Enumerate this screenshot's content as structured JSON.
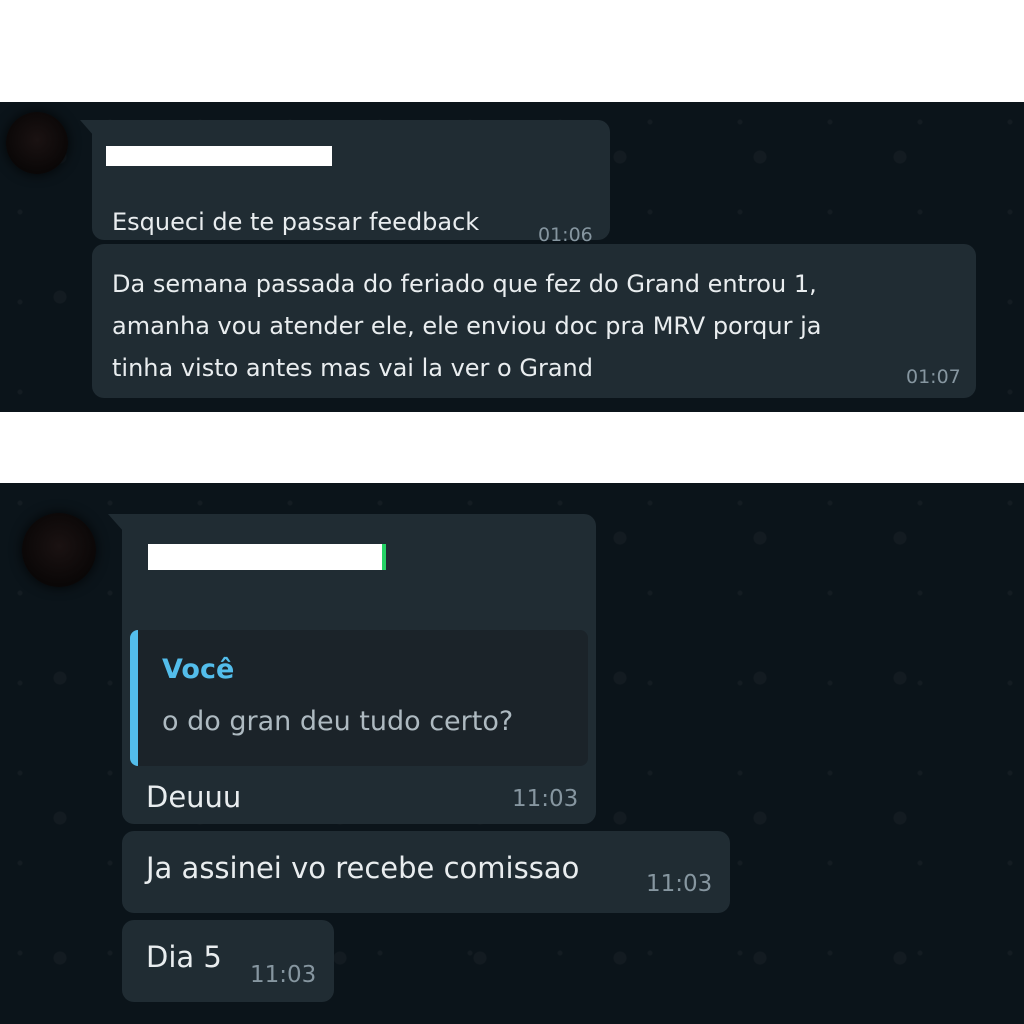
{
  "screenshots": [
    {
      "messages": [
        {
          "text": "Esqueci de te passar feedback",
          "time": "01:06",
          "sender_redacted": true
        },
        {
          "text": "Da semana passada do feriado que fez do Grand entrou 1,\namanha vou atender ele, ele enviou doc pra MRV porqur ja\ntinha visto antes mas vai la ver o Grand",
          "time": "01:07"
        }
      ]
    },
    {
      "messages": [
        {
          "sender_redacted": true,
          "quote": {
            "author": "Você",
            "text": "o do gran deu tudo certo?"
          },
          "text": "Deuuu",
          "time": "11:03"
        },
        {
          "text": "Ja assinei vo recebe comissao",
          "time": "11:03"
        },
        {
          "text": "Dia 5",
          "time": "11:03"
        }
      ]
    }
  ],
  "colors": {
    "chat_background": "#0b141a",
    "bubble_incoming": "#202c33",
    "text_primary": "#e9edef",
    "text_secondary": "#8696a0",
    "quote_accent": "#53bdeb"
  }
}
